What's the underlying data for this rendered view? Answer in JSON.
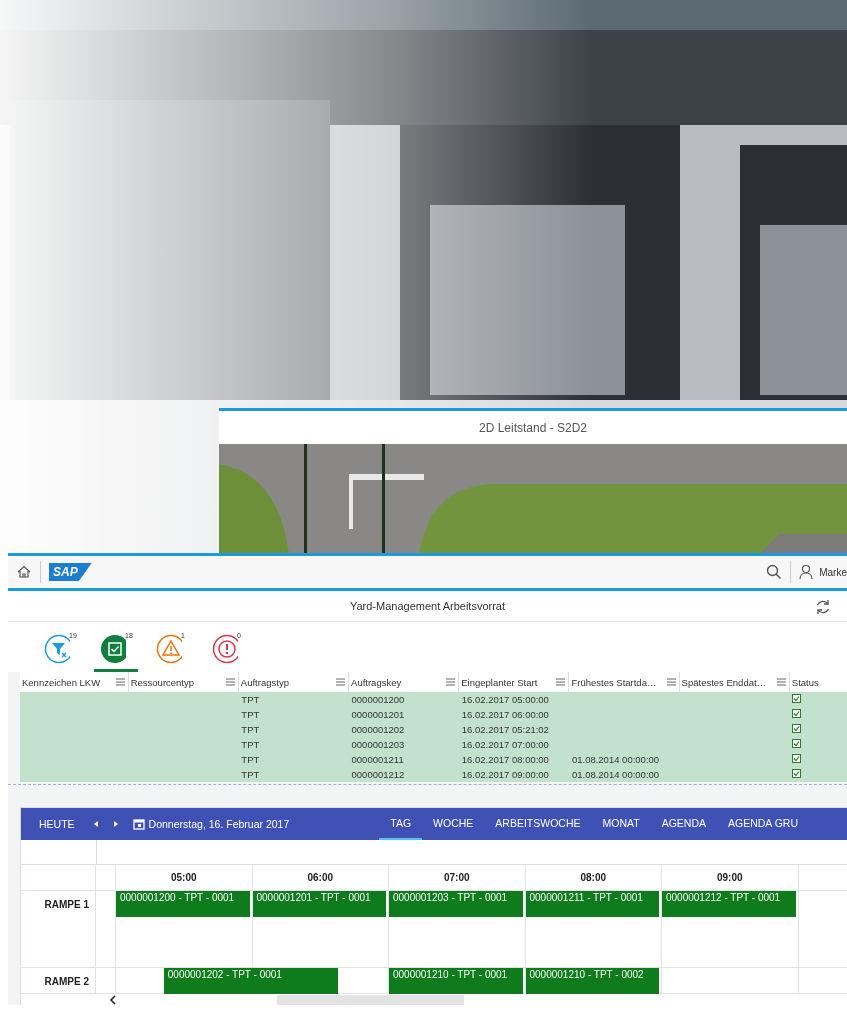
{
  "map_window": {
    "title": "2D Leitstand - S2D2"
  },
  "shell": {
    "logo": "SAP",
    "user": "Marke"
  },
  "page_title": "Yard-Management Arbeitsvorrat",
  "filter_tabs": [
    {
      "kind": "all",
      "count": "19",
      "selected": false
    },
    {
      "kind": "ok",
      "count": "18",
      "selected": true
    },
    {
      "kind": "warning",
      "count": "1",
      "selected": false
    },
    {
      "kind": "error",
      "count": "0",
      "selected": false
    }
  ],
  "table": {
    "columns": [
      "Kennzeichen LKW",
      "Ressourcentyp",
      "Auftragstyp",
      "Auftragskey",
      "Eingeplanter Start",
      "Frühestes Startda…",
      "Spätestes Enddat…",
      "Status"
    ],
    "rows": [
      {
        "selected": true,
        "cells": [
          "",
          "",
          "TPT",
          "0000001200",
          "16.02.2017 05:00:00",
          "",
          ""
        ],
        "status_checked": true
      },
      {
        "selected": true,
        "cells": [
          "",
          "",
          "TPT",
          "0000001201",
          "16.02.2017 06:00:00",
          "",
          ""
        ],
        "status_checked": true
      },
      {
        "selected": true,
        "cells": [
          "",
          "",
          "TPT",
          "0000001202",
          "16.02.2017 05:21:02",
          "",
          ""
        ],
        "status_checked": true
      },
      {
        "selected": true,
        "cells": [
          "",
          "",
          "TPT",
          "0000001203",
          "16.02.2017 07:00:00",
          "",
          ""
        ],
        "status_checked": true
      },
      {
        "selected": true,
        "cells": [
          "",
          "",
          "TPT",
          "0000001211",
          "16.02.2017 08:00:00",
          "01.08.2014 00:00:00",
          ""
        ],
        "status_checked": true
      },
      {
        "selected": true,
        "cells": [
          "",
          "",
          "TPT",
          "0000001212",
          "16.02.2017 09:00:00",
          "01.08.2014 00:00:00",
          ""
        ],
        "status_checked": true
      }
    ]
  },
  "calendar": {
    "today": "HEUTE",
    "date": "Donnerstag, 16. Februar 2017",
    "views": [
      {
        "label": "TAG",
        "selected": true
      },
      {
        "label": "WOCHE",
        "selected": false
      },
      {
        "label": "ARBEITSWOCHE",
        "selected": false
      },
      {
        "label": "MONAT",
        "selected": false
      },
      {
        "label": "AGENDA",
        "selected": false
      },
      {
        "label": "AGENDA GRU",
        "selected": false
      }
    ],
    "hours": [
      "05:00",
      "06:00",
      "07:00",
      "08:00",
      "09:00"
    ],
    "resources": [
      {
        "name": "RAMPE 1",
        "slots": [
          {
            "title": "0000001200 - TPT - 0001",
            "kind": "full"
          },
          {
            "title": "0000001201 - TPT - 0001",
            "kind": "full"
          },
          {
            "title": "0000001203 - TPT - 0001",
            "kind": "full"
          },
          {
            "title": "0000001211 - TPT - 0001",
            "kind": "full"
          },
          {
            "title": "0000001212 - TPT - 0001",
            "kind": "full"
          }
        ]
      },
      {
        "name": "RAMPE 2",
        "slots": [
          {
            "title": "0000001202 - TPT - 0001",
            "kind": "offset"
          },
          {
            "title": "0000001210 - TPT - 0001",
            "kind": "after_gap"
          },
          {
            "title": "0000001210 - TPT - 0002",
            "kind": "full"
          }
        ]
      }
    ]
  }
}
